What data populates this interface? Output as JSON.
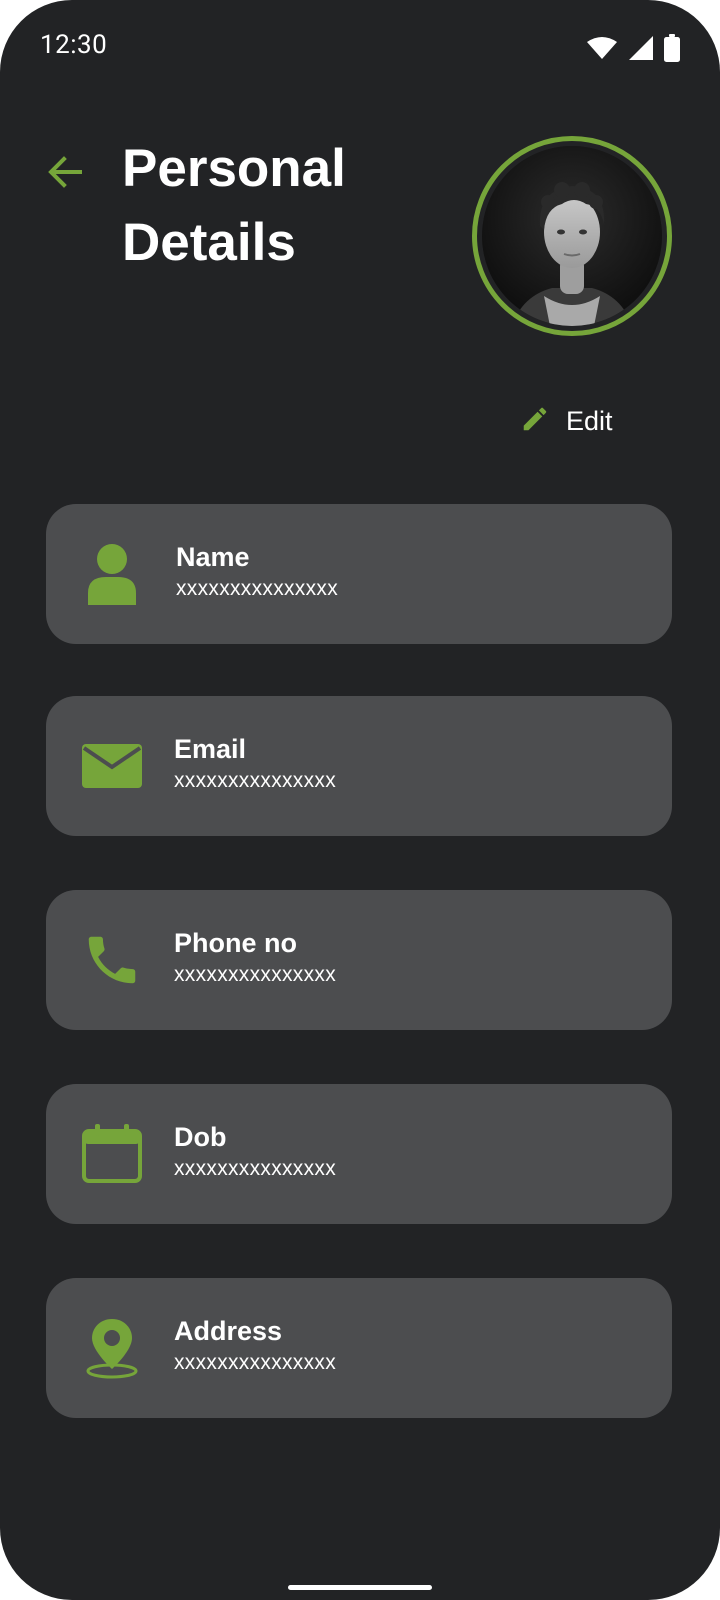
{
  "status_bar": {
    "time": "12:30",
    "icons": [
      "wifi-icon",
      "cell-signal-icon",
      "battery-icon"
    ]
  },
  "header": {
    "back_icon": "arrow-left-icon",
    "title_line1": "Personal",
    "title_line2": "Details",
    "avatar": "profile-photo"
  },
  "edit": {
    "icon": "pencil-icon",
    "label": "Edit"
  },
  "details": [
    {
      "icon": "person-icon",
      "label": "Name",
      "value": "xxxxxxxxxxxxxxx"
    },
    {
      "icon": "email-icon",
      "label": "Email",
      "value": "xxxxxxxxxxxxxxx"
    },
    {
      "icon": "phone-icon",
      "label": "Phone no",
      "value": "xxxxxxxxxxxxxxx"
    },
    {
      "icon": "calendar-icon",
      "label": "Dob",
      "value": "xxxxxxxxxxxxxxx"
    },
    {
      "icon": "location-pin-icon",
      "label": "Address",
      "value": "xxxxxxxxxxxxxxx"
    }
  ],
  "colors": {
    "background": "#222325",
    "card": "#4c4d4f",
    "accent": "#76a53a",
    "text": "#ffffff"
  }
}
